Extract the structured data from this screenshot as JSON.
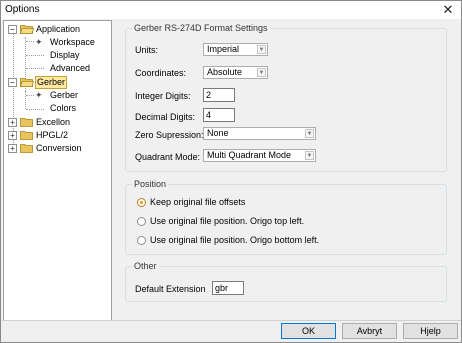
{
  "window": {
    "title": "Options"
  },
  "tree": {
    "items": [
      {
        "label": "Application",
        "expander": "−",
        "kind": "folder-open"
      },
      {
        "label": "Workspace",
        "kind": "gear-leaf"
      },
      {
        "label": "Display",
        "kind": "leaf"
      },
      {
        "label": "Advanced",
        "kind": "leaf"
      },
      {
        "label": "Gerber",
        "expander": "−",
        "kind": "folder-open",
        "selected": true
      },
      {
        "label": "Gerber",
        "kind": "gear-leaf"
      },
      {
        "label": "Colors",
        "kind": "leaf"
      },
      {
        "label": "Excellon",
        "expander": "+",
        "kind": "folder"
      },
      {
        "label": "HPGL/2",
        "expander": "+",
        "kind": "folder"
      },
      {
        "label": "Conversion",
        "expander": "+",
        "kind": "folder"
      }
    ]
  },
  "format_group": {
    "legend": "Gerber RS-274D Format Settings",
    "units": {
      "label": "Units:",
      "value": "Imperial"
    },
    "coordinates": {
      "label": "Coordinates:",
      "value": "Absolute"
    },
    "integer_digits": {
      "label": "Integer Digits:",
      "value": "2"
    },
    "decimal_digits": {
      "label": "Decimal Digits:",
      "value": "4"
    },
    "zero_suppression": {
      "label": "Zero Supression:",
      "value": "None"
    },
    "quadrant_mode": {
      "label": "Quadrant Mode:",
      "value": "Multi Quadrant Mode"
    }
  },
  "position_group": {
    "legend": "Position",
    "options": [
      {
        "label": "Keep original file offsets",
        "checked": true
      },
      {
        "label": "Use original file position. Origo top left.",
        "checked": false
      },
      {
        "label": "Use original file position. Origo bottom left.",
        "checked": false
      }
    ]
  },
  "other_group": {
    "legend": "Other",
    "default_extension": {
      "label": "Default Extension",
      "value": "gbr"
    }
  },
  "buttons": {
    "ok": "OK",
    "cancel": "Avbryt",
    "help": "Hjelp"
  },
  "colors": {
    "selection_bg": "#ffe9a3",
    "folder": "#e8c45a",
    "default_button_border": "#0078d7"
  }
}
